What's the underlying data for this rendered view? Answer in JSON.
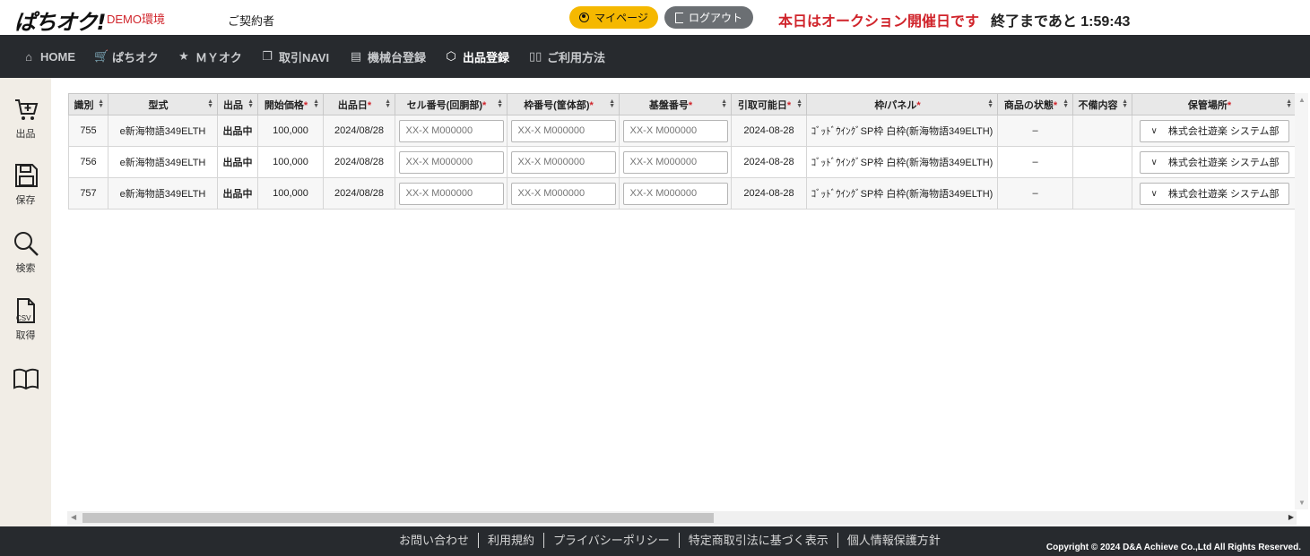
{
  "header": {
    "logo": "ぱちオク!",
    "demo_label": "DEMO環境",
    "contractor": "ご契約者",
    "mypage_label": "マイページ",
    "logout_label": "ログアウト",
    "auction_today": "本日はオークション開催日です",
    "remaining": "終了まであと 1:59:43"
  },
  "nav": {
    "items": [
      {
        "label": "HOME",
        "icon": "home-icon"
      },
      {
        "label": "ぱちオク",
        "icon": "cart-icon"
      },
      {
        "label": "ＭＹオク",
        "icon": "star-icon"
      },
      {
        "label": "取引NAVI",
        "icon": "copy-icon"
      },
      {
        "label": "機械台登録",
        "icon": "list-icon"
      },
      {
        "label": "出品登録",
        "icon": "box-icon"
      },
      {
        "label": "ご利用方法",
        "icon": "book-icon"
      }
    ]
  },
  "sidebar": {
    "items": [
      {
        "label": "出品",
        "icon": "cart-plus-icon"
      },
      {
        "label": "保存",
        "icon": "save-icon"
      },
      {
        "label": "検索",
        "icon": "search-icon"
      },
      {
        "label": "取得",
        "icon": "csv-icon"
      },
      {
        "label": "",
        "icon": "book-icon"
      }
    ]
  },
  "table": {
    "headers": [
      "識別",
      "型式",
      "出品",
      "開始価格",
      "出品日",
      "セル番号(回胴部)",
      "枠番号(筐体部)",
      "基盤番号",
      "引取可能日",
      "枠/パネル",
      "商品の状態",
      "不備内容",
      "保管場所"
    ],
    "required": [
      "開始価格",
      "出品日",
      "セル番号(回胴部)",
      "枠番号(筐体部)",
      "基盤番号",
      "引取可能日",
      "枠/パネル",
      "商品の状態",
      "保管場所"
    ],
    "rows": [
      {
        "id": "755",
        "model": "e新海物語349ELTH",
        "status": "出品中",
        "price": "100,000",
        "listing_date": "2024/08/28",
        "cell_placeholder": "XX-X M000000",
        "frame_placeholder": "XX-X M000000",
        "board_placeholder": "XX-X M000000",
        "pickup_date": "2024-08-28",
        "panel": "ｺﾞｯﾄﾞｳｲﾝｸﾞSP枠 白枠(新海物語349ELTH)",
        "condition": "–",
        "defect": "",
        "location": "株式会社遊楽 システム部"
      },
      {
        "id": "756",
        "model": "e新海物語349ELTH",
        "status": "出品中",
        "price": "100,000",
        "listing_date": "2024/08/28",
        "cell_placeholder": "XX-X M000000",
        "frame_placeholder": "XX-X M000000",
        "board_placeholder": "XX-X M000000",
        "pickup_date": "2024-08-28",
        "panel": "ｺﾞｯﾄﾞｳｲﾝｸﾞSP枠 白枠(新海物語349ELTH)",
        "condition": "–",
        "defect": "",
        "location": "株式会社遊楽 システム部"
      },
      {
        "id": "757",
        "model": "e新海物語349ELTH",
        "status": "出品中",
        "price": "100,000",
        "listing_date": "2024/08/28",
        "cell_placeholder": "XX-X M000000",
        "frame_placeholder": "XX-X M000000",
        "board_placeholder": "XX-X M000000",
        "pickup_date": "2024-08-28",
        "panel": "ｺﾞｯﾄﾞｳｲﾝｸﾞSP枠 白枠(新海物語349ELTH)",
        "condition": "–",
        "defect": "",
        "location": "株式会社遊楽 システム部"
      }
    ]
  },
  "footer": {
    "links": [
      "お問い合わせ",
      "利用規約",
      "プライバシーポリシー",
      "特定商取引法に基づく表示",
      "個人情報保護方針"
    ],
    "copyright": "Copyright © 2024 D&A Achieve Co.,Ltd All Rights Reserved."
  },
  "colors": {
    "accent_red": "#d0242b",
    "mypage_yellow": "#f5b800",
    "logout_gray": "#6b6f73",
    "nav_dark": "#272a2e",
    "status_green": "#1a7c3c",
    "sidebar_beige": "#f1ede6"
  }
}
